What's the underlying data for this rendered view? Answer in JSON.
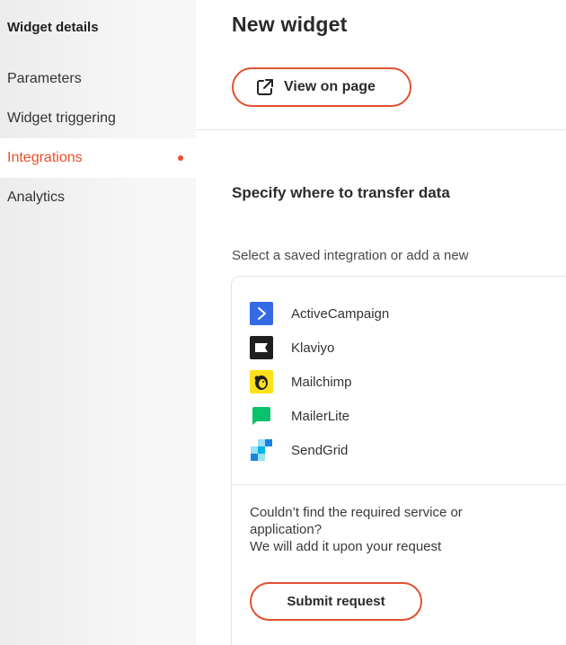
{
  "sidebar": {
    "title": "Widget details",
    "items": [
      {
        "label": "Parameters",
        "active": false
      },
      {
        "label": "Widget triggering",
        "active": false
      },
      {
        "label": "Integrations",
        "active": true
      },
      {
        "label": "Analytics",
        "active": false
      }
    ]
  },
  "main": {
    "title": "New widget",
    "view_button": {
      "label": "View on page",
      "icon": "external-link-icon"
    },
    "section_title": "Specify where to transfer data",
    "subtitle": "Select a saved integration or add a new",
    "integrations": [
      {
        "label": "ActiveCampaign",
        "icon": "activecampaign-icon"
      },
      {
        "label": "Klaviyo",
        "icon": "klaviyo-icon"
      },
      {
        "label": "Mailchimp",
        "icon": "mailchimp-icon"
      },
      {
        "label": "MailerLite",
        "icon": "mailerlite-icon"
      },
      {
        "label": "SendGrid",
        "icon": "sendgrid-icon"
      }
    ],
    "help": {
      "line1": "Couldn’t find the required service or",
      "line2": "application?",
      "line3": "We will add it upon your request"
    },
    "submit_button": {
      "label": "Submit request"
    }
  },
  "colors": {
    "accent": "#ec4d2b",
    "activecampaign": "#356ae6",
    "klaviyo": "#1f1f1f",
    "mailchimp": "#ffe01b",
    "mailerlite": "#09c269",
    "sendgrid": "#1a82e2"
  }
}
